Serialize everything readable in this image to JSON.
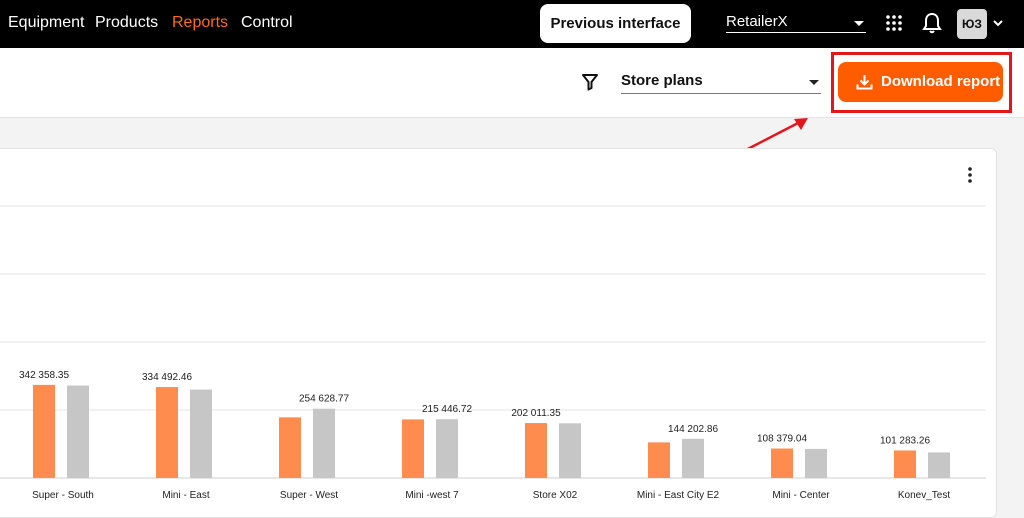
{
  "nav": {
    "items": [
      {
        "label": "Equipment",
        "active": false
      },
      {
        "label": "Products",
        "active": false
      },
      {
        "label": "Reports",
        "active": true
      },
      {
        "label": "Control",
        "active": false
      }
    ],
    "prev_interface_label": "Previous interface",
    "retailer": "RetailerX",
    "avatar_initials": "ЮЗ",
    "icons": [
      "apps-grid-icon",
      "bell-icon",
      "chevron-down-icon"
    ]
  },
  "toolbar": {
    "filter_icon": "filter-icon",
    "store_plans_label": "Store plans",
    "download_label": "Download report",
    "download_icon": "download-icon"
  },
  "colors": {
    "accent": "#ff5c00",
    "active_nav": "#ff6a1f",
    "highlight": "#e4151b",
    "bar_primary": "#ff8c4f",
    "bar_secondary": "#c6c6c6"
  },
  "chart_data": {
    "type": "bar",
    "categories": [
      "Super - South",
      "Mini - East",
      "Super - West",
      "Mini -west 7",
      "Store X02",
      "Mini - East City E2",
      "Mini - Center",
      "Konev_Test"
    ],
    "series": [
      {
        "values": [
          342358.35,
          334492.46,
          223000,
          215446.72,
          202011.35,
          131000,
          108379.04,
          101283.26
        ]
      },
      {
        "values": [
          340000,
          325000,
          254628.77,
          216000,
          201000,
          144202.86,
          107000,
          94000
        ]
      }
    ],
    "data_labels": [
      "342 358.35",
      "334 492.46",
      "254 628.77",
      "215 446.72",
      "202 011.35",
      "144 202.86",
      "108 379.04",
      "101 283.26"
    ],
    "ylim": [
      0,
      1000000
    ],
    "grid": true
  }
}
